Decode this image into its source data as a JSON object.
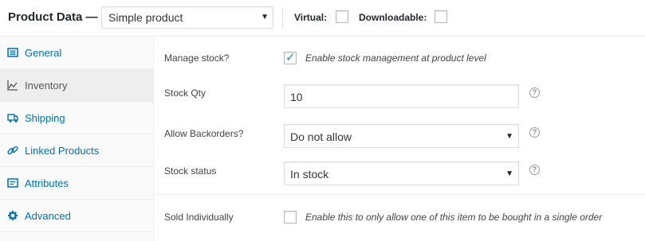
{
  "header": {
    "title": "Product Data —",
    "product_type": "Simple product",
    "virtual_label": "Virtual:",
    "downloadable_label": "Downloadable:"
  },
  "sidebar": {
    "tabs": [
      {
        "label": "General",
        "icon": "general-icon"
      },
      {
        "label": "Inventory",
        "icon": "inventory-icon",
        "active": true
      },
      {
        "label": "Shipping",
        "icon": "shipping-icon"
      },
      {
        "label": "Linked Products",
        "icon": "link-icon"
      },
      {
        "label": "Attributes",
        "icon": "attributes-icon"
      },
      {
        "label": "Advanced",
        "icon": "gear-icon"
      }
    ]
  },
  "inventory": {
    "manage_stock": {
      "label": "Manage stock?",
      "checked": true,
      "description": "Enable stock management at product level"
    },
    "stock_qty": {
      "label": "Stock Qty",
      "value": "10"
    },
    "backorders": {
      "label": "Allow Backorders?",
      "value": "Do not allow"
    },
    "stock_status": {
      "label": "Stock status",
      "value": "In stock"
    },
    "sold_individually": {
      "label": "Sold Individually",
      "checked": false,
      "description": "Enable this to only allow one of this item to be bought in a single order"
    }
  },
  "colors": {
    "link": "#0073aa",
    "check": "#1e8cbe",
    "active_tab_bg": "#eeeeee"
  }
}
